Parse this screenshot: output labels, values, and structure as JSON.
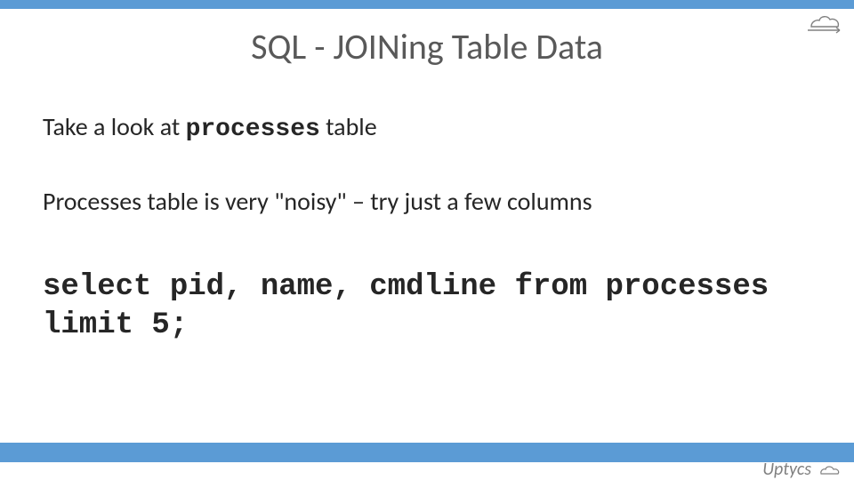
{
  "title": "SQL - JOINing Table Data",
  "line1_prefix": "Take a look at ",
  "line1_bold": "processes",
  "line1_suffix": " table",
  "line2": "Processes table is very \"noisy\" – try just a few columns",
  "code": "select pid, name, cmdline from processes limit 5;",
  "brand": "Uptycs",
  "colors": {
    "accent": "#5b9bd5",
    "text": "#595959"
  }
}
